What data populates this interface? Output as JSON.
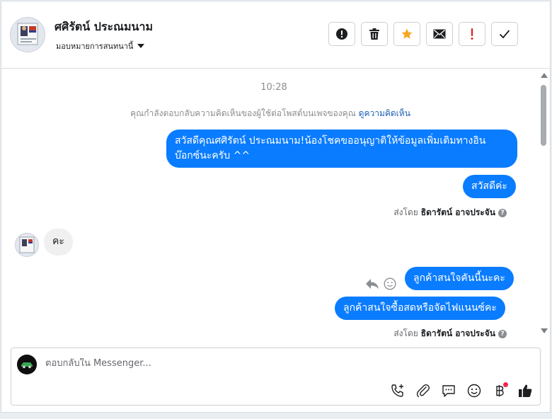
{
  "header": {
    "contact_name": "ศศิรัตน์ ประณมนาม",
    "assign_label": "มอบหมายการสนทนานี้",
    "actions": [
      {
        "name": "spam-button",
        "icon": "exclamation-circle-icon"
      },
      {
        "name": "delete-button",
        "icon": "trash-icon"
      },
      {
        "name": "star-button",
        "icon": "star-icon"
      },
      {
        "name": "mark-unread-button",
        "icon": "envelope-icon"
      },
      {
        "name": "follow-up-button",
        "icon": "red-exclamation-icon"
      },
      {
        "name": "mark-done-button",
        "icon": "checkmark-icon"
      }
    ]
  },
  "conversation": {
    "timestamp": "10:28",
    "system_note": {
      "text": "คุณกำลังตอบกลับความคิดเห็นของผู้ใช้ต่อโพสต์บนเพจของคุณ",
      "link": "ดูความคิดเห็น"
    },
    "messages": [
      {
        "direction": "out",
        "text": "สวัสดีคุณศศิรัตน์ ประณมนาม!น้องโชคขออนุญาติให้ข้อมูลเพิ่มเติมทางอินบ๊อกซ์นะครับ ^^"
      },
      {
        "direction": "out",
        "text": "สวัสดีค่ะ"
      },
      {
        "direction": "in",
        "text": "คะ"
      },
      {
        "direction": "out",
        "text": "ลูกค้าสนใจคันนี้นะคะ"
      },
      {
        "direction": "out",
        "text": "ลูกค้าสนใจซื้อสดหรือจัดไฟแนนซ์คะ"
      }
    ],
    "sent_by_prefix": "ส่งโดย",
    "sent_by_name": "ธิดารัตน์ อาจประจัน",
    "help_glyph": "?"
  },
  "composer": {
    "placeholder": "ตอบกลับใน Messenger...",
    "tools": [
      "call-icon",
      "paperclip-icon",
      "chat-bubble-icon",
      "emoji-icon",
      "baht-icon",
      "thumbs-up-icon"
    ]
  },
  "colors": {
    "outgoing_bubble": "#0a7cff",
    "incoming_bubble": "#f0f0f0",
    "star": "#f5a623",
    "alert_red": "#e02424",
    "link": "#1a5fb4"
  }
}
